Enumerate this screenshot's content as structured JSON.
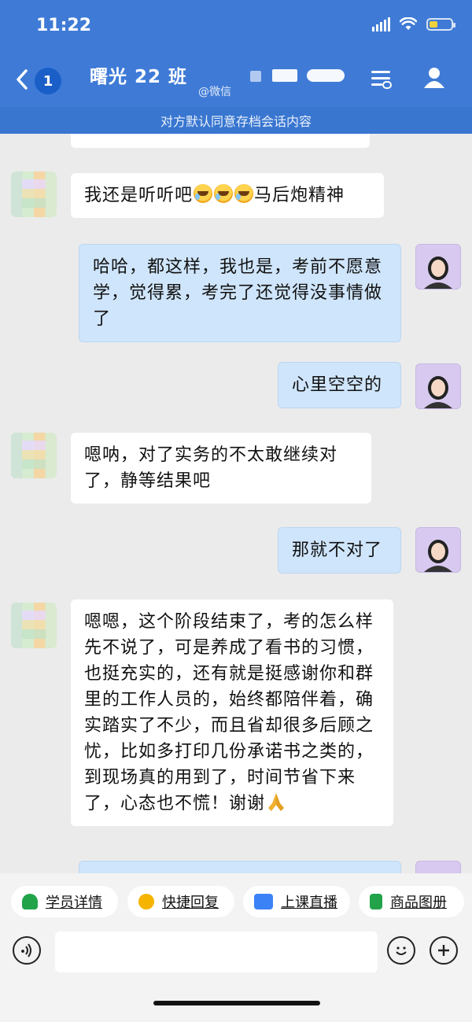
{
  "status_bar": {
    "time": "11:22"
  },
  "header": {
    "badge_count": "1",
    "title": "曙光 22 班",
    "subtitle": "@微信"
  },
  "notice": "对方默认同意存档会话内容",
  "messages": [
    {
      "from": "peer",
      "text": "我还是听听吧",
      "emoji_count": 3,
      "text_after": "马后炮精神"
    },
    {
      "from": "me",
      "text": "哈哈，都这样，我也是，考前不愿意学，觉得累，考完了还觉得没事情做了"
    },
    {
      "from": "me",
      "text": "心里空空的"
    },
    {
      "from": "peer",
      "text": "嗯呐，对了实务的不太敢继续对了，静等结果吧"
    },
    {
      "from": "me",
      "text": "那就不对了"
    },
    {
      "from": "peer",
      "text": "嗯嗯，这个阶段结束了，考的怎么样先不说了，可是养成了看书的习惯，也挺充实的，还有就是挺感谢你和群里的工作人员的，始终都陪伴着，确实踏实了不少，而且省却很多后顾之忧，比如多打印几份承诺书之类的，到现场真的用到了，时间节省下来了，心态也不慌！谢谢",
      "emoji": "folded-hands"
    }
  ],
  "quick_actions": [
    {
      "label": "学员详情",
      "icon": "student-icon",
      "color": "#21a34a"
    },
    {
      "label": "快捷回复",
      "icon": "quick-reply-icon",
      "color": "#f5b400"
    },
    {
      "label": "上课直播",
      "icon": "live-icon",
      "color": "#3b82f6"
    },
    {
      "label": "商品图册",
      "icon": "catalog-icon",
      "color": "#22a34a"
    }
  ],
  "input": {
    "placeholder": ""
  }
}
